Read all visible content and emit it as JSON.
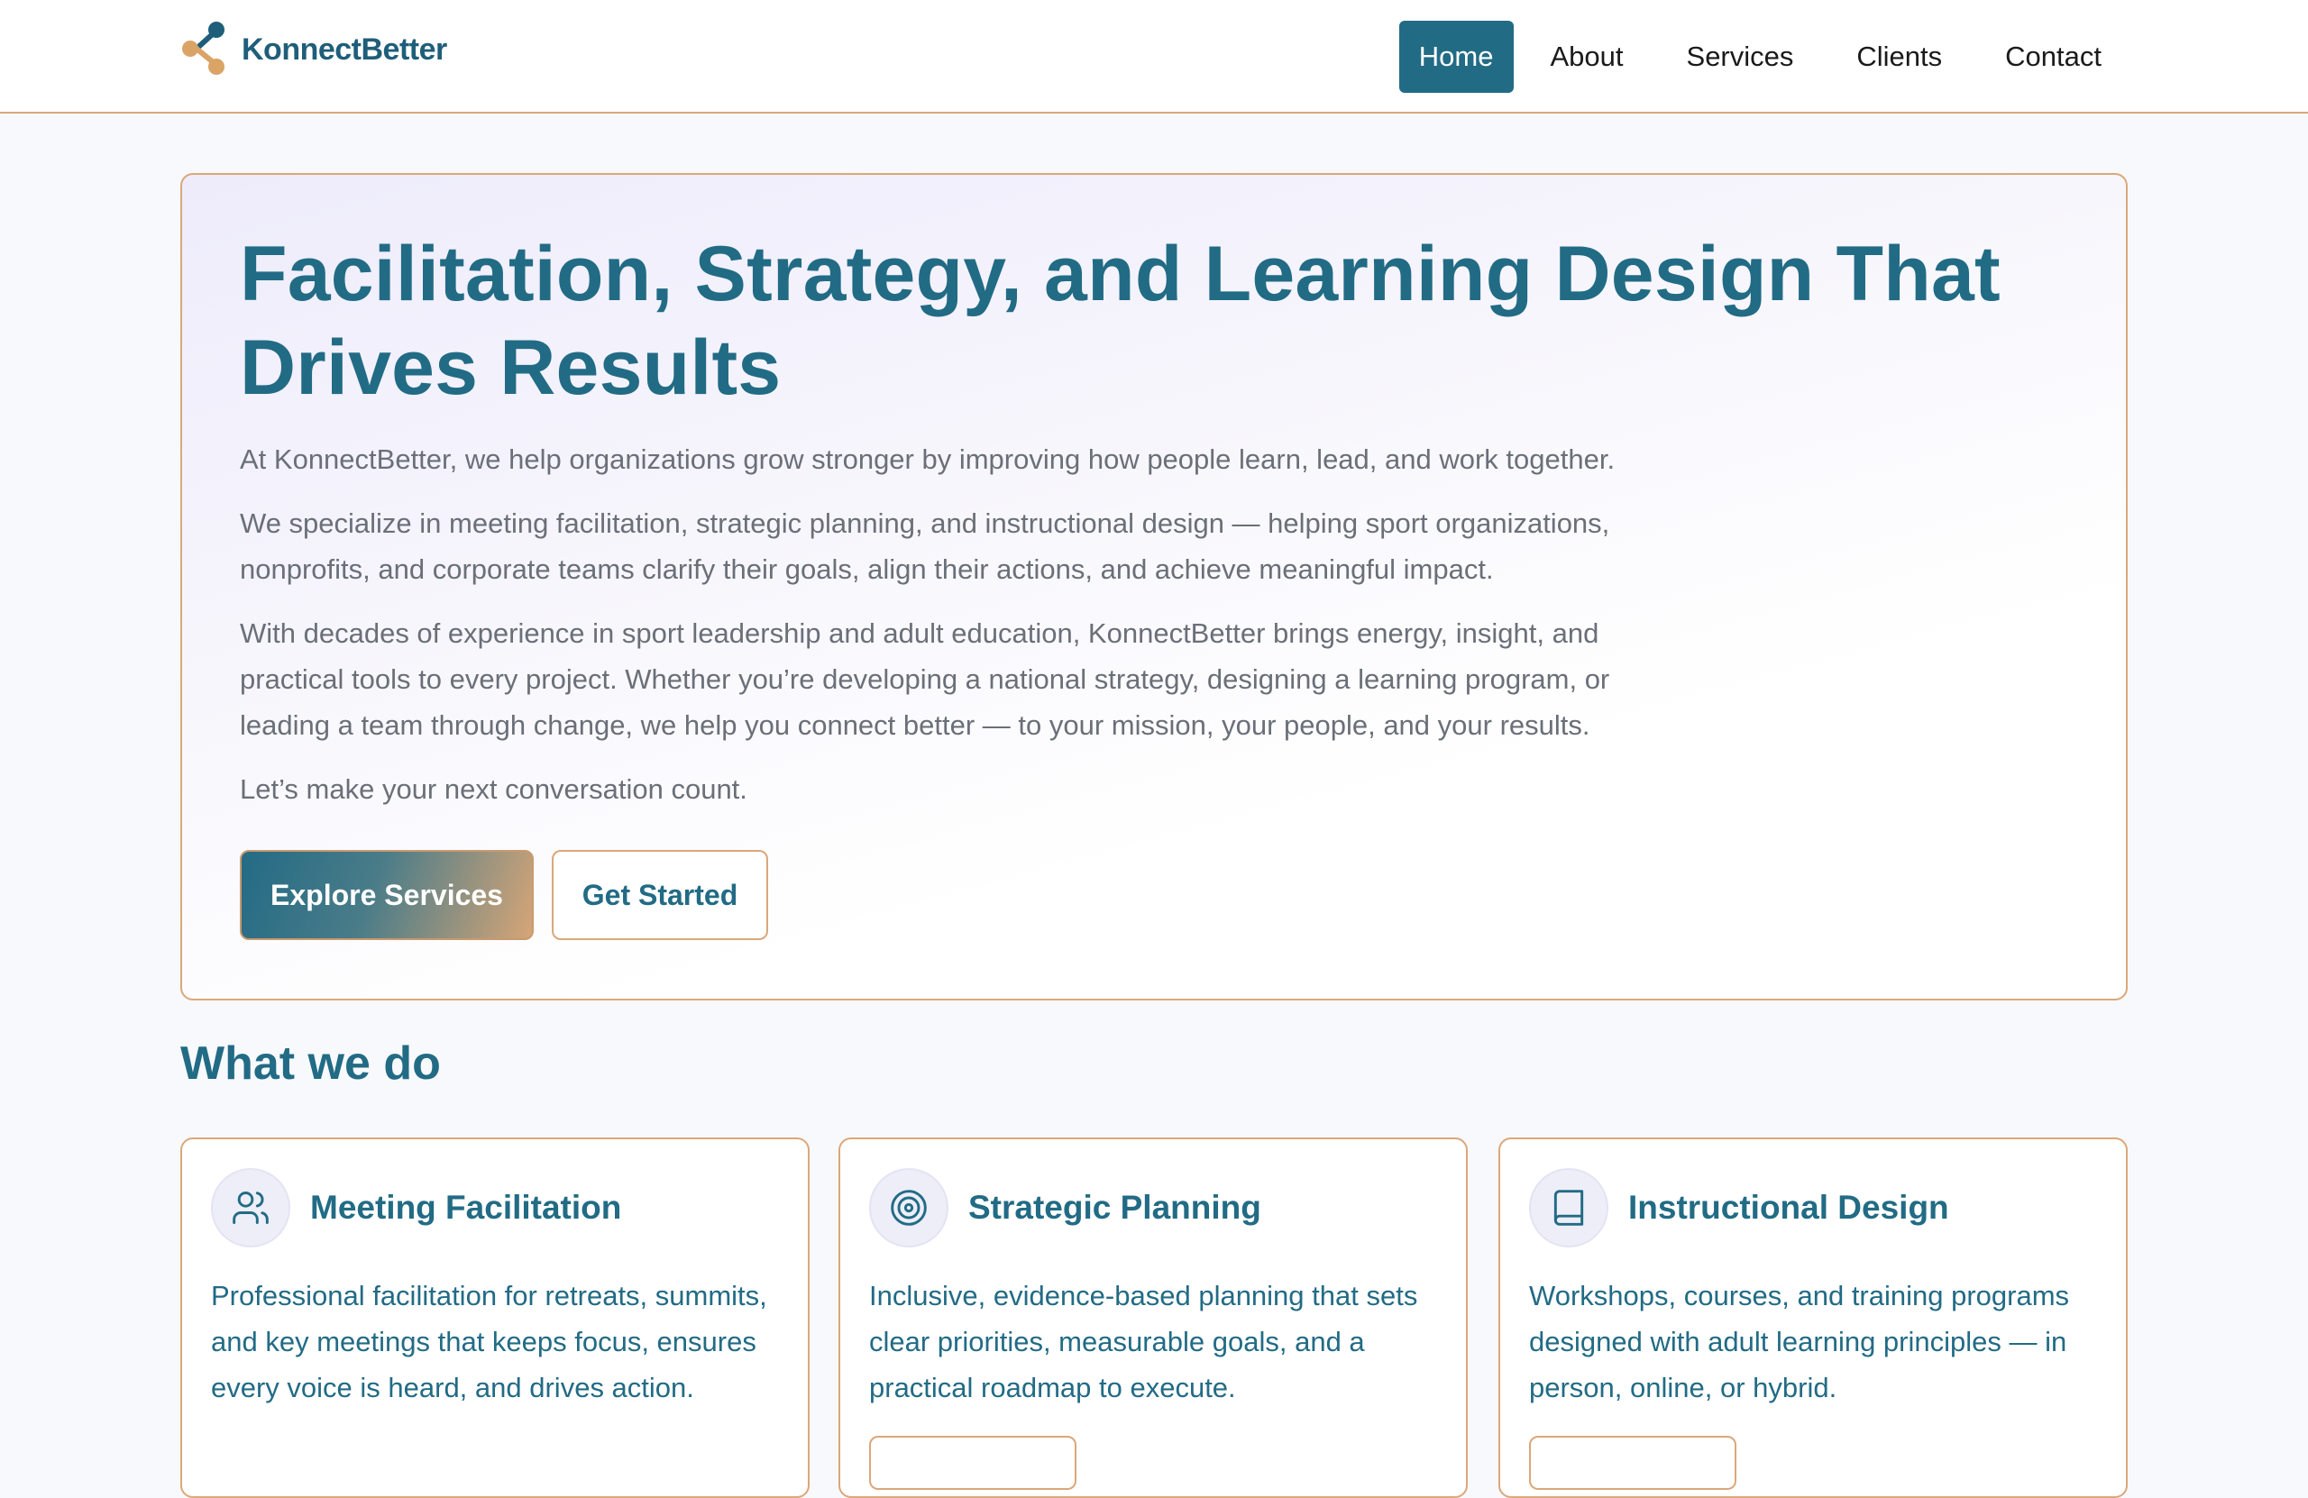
{
  "brand": {
    "name": "KonnectBetter"
  },
  "nav": {
    "items": [
      {
        "label": "Home",
        "active": true
      },
      {
        "label": "About",
        "active": false
      },
      {
        "label": "Services",
        "active": false
      },
      {
        "label": "Clients",
        "active": false
      },
      {
        "label": "Contact",
        "active": false
      }
    ]
  },
  "hero": {
    "title": "Facilitation, Strategy, and Learning Design That Drives Results",
    "paragraphs": [
      "At KonnectBetter, we help organizations grow stronger by improving how people learn, lead, and work together.",
      "We specialize in meeting facilitation, strategic planning, and instructional design — helping sport organizations, nonprofits, and corporate teams clarify their goals, align their actions, and achieve meaningful impact.",
      "With decades of experience in sport leadership and adult education, KonnectBetter brings energy, insight, and practical tools to every project. Whether you’re developing a national strategy, designing a learning program, or leading a team through change, we help you connect better — to your mission, your people, and your results.",
      "Let’s make your next conversation count."
    ],
    "primary_button": "Explore Services",
    "secondary_button": "Get Started"
  },
  "services": {
    "title": "What we do",
    "cards": [
      {
        "icon": "people-icon",
        "title": "Meeting Facilitation",
        "text": "Professional facilitation for retreats, summits, and key meetings that keeps focus, ensures every voice is heard, and drives action."
      },
      {
        "icon": "target-icon",
        "title": "Strategic Planning",
        "text": "Inclusive, evidence-based planning that sets clear priorities, measurable goals, and a practical roadmap to execute."
      },
      {
        "icon": "book-icon",
        "title": "Instructional Design",
        "text": "Workshops, courses, and training programs designed with adult learning principles — in person, online, or hybrid."
      }
    ]
  },
  "colors": {
    "primary": "#226b85",
    "accent": "#dba77a",
    "body_text": "#6a6f78"
  }
}
